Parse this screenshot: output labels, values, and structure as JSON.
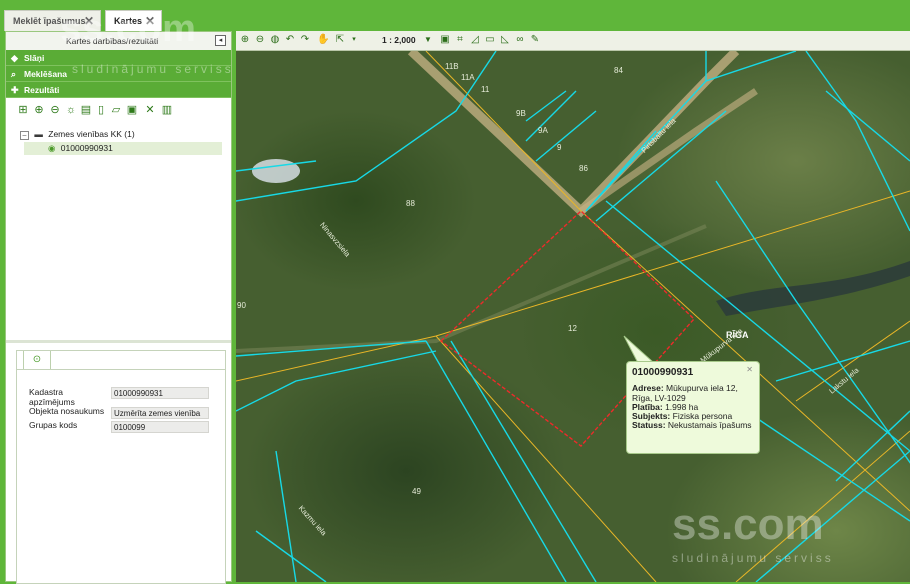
{
  "tabs": [
    {
      "label": "Meklēt īpašumus",
      "active": false
    },
    {
      "label": "Kartes",
      "active": true
    }
  ],
  "left_panel": {
    "header_title": "Kartes darbības/rezultāti",
    "accordion": {
      "layers": "Slāņi",
      "search": "Meklēšana",
      "results": "Rezultāti"
    },
    "toolbar_icons": [
      "select-all-icon",
      "zoom-in-icon",
      "zoom-out-icon",
      "bulb-icon",
      "folder-icon",
      "document-icon",
      "export-icon",
      "print-icon",
      "close-icon",
      "delete-icon"
    ],
    "tree": {
      "group_label": "Zemes vienības KK (1)",
      "item_label": "01000990931"
    },
    "details": [
      {
        "label": "Kadastra apzīmējums",
        "value": "01000990931"
      },
      {
        "label": "Objekta nosaukums",
        "value": "Uzmērīta zemes vienība"
      },
      {
        "label": "Grupas kods",
        "value": "0100099"
      }
    ]
  },
  "map_toolbar": {
    "scale": "1 : 2,000",
    "icons": [
      "zoom-in-icon",
      "zoom-out-icon",
      "globe-icon",
      "back-icon",
      "forward-icon",
      "pan-icon",
      "select-icon",
      "print-icon",
      "measure-icon",
      "polygon-icon",
      "comment-icon",
      "link-icon",
      "pin-icon"
    ]
  },
  "map": {
    "labels": {
      "p11b": "11B",
      "p11a": "11A",
      "p11": "11",
      "p84": "84",
      "p9b": "9B",
      "p9a": "9A",
      "p9": "9",
      "p86": "86",
      "p88": "88",
      "p90": "90",
      "p12": "12",
      "p49": "49",
      "riga": "RĪGA",
      "street1": "Ninasvzsiela",
      "street2": "Mūkupurva iela",
      "street3": "Lakstu iela",
      "street4": "Kazmu iela",
      "street5": "Pirtsbaltu iela"
    },
    "popup": {
      "title": "01000990931",
      "address_label": "Adrese:",
      "address": "Mūkupurva iela 12, Rīga, LV-1029",
      "area_label": "Platība:",
      "area": "1.998 ha",
      "subject_label": "Subjekts:",
      "subject": "Fiziska persona",
      "status_label": "Statuss:",
      "status": "Nekustamais īpašums"
    }
  },
  "watermarks": {
    "brand": "ss.com",
    "tagline": "sludinājumu serviss"
  }
}
